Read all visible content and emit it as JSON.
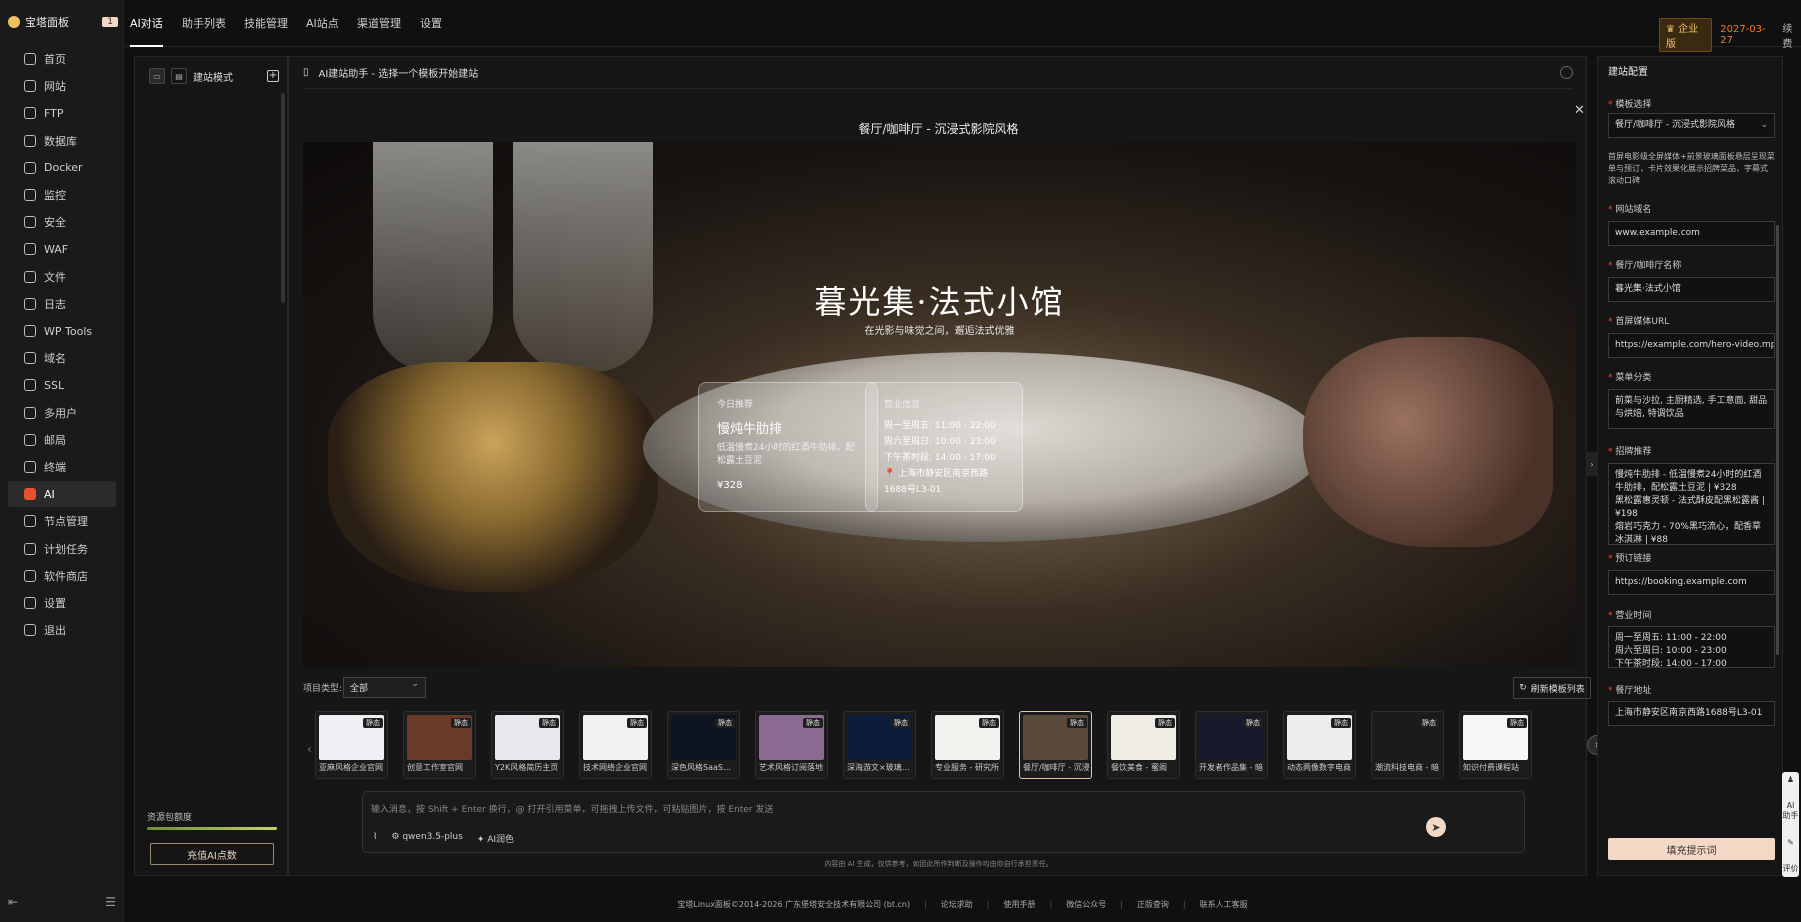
{
  "brand": {
    "name": "宝塔面板",
    "badge": "1"
  },
  "sidebar": {
    "items": [
      {
        "label": "首页",
        "icon": "home-icon"
      },
      {
        "label": "网站",
        "icon": "globe-icon"
      },
      {
        "label": "FTP",
        "icon": "ftp-icon"
      },
      {
        "label": "数据库",
        "icon": "database-icon"
      },
      {
        "label": "Docker",
        "icon": "docker-icon"
      },
      {
        "label": "监控",
        "icon": "monitor-icon"
      },
      {
        "label": "安全",
        "icon": "shield-icon"
      },
      {
        "label": "WAF",
        "icon": "waf-icon"
      },
      {
        "label": "文件",
        "icon": "folder-icon"
      },
      {
        "label": "日志",
        "icon": "log-icon"
      },
      {
        "label": "WP Tools",
        "icon": "wordpress-icon"
      },
      {
        "label": "域名",
        "icon": "domain-icon"
      },
      {
        "label": "SSL",
        "icon": "ssl-icon"
      },
      {
        "label": "多用户",
        "icon": "users-icon"
      },
      {
        "label": "邮局",
        "icon": "mail-icon"
      },
      {
        "label": "终端",
        "icon": "terminal-icon"
      },
      {
        "label": "AI",
        "icon": "ai-icon"
      },
      {
        "label": "节点管理",
        "icon": "node-icon"
      },
      {
        "label": "计划任务",
        "icon": "cron-icon"
      },
      {
        "label": "软件商店",
        "icon": "store-icon"
      },
      {
        "label": "设置",
        "icon": "gear-icon"
      },
      {
        "label": "退出",
        "icon": "logout-icon"
      }
    ],
    "active": "AI"
  },
  "topnav": {
    "tabs": [
      "AI对话",
      "助手列表",
      "技能管理",
      "AI站点",
      "渠道管理",
      "设置"
    ],
    "edition": "企业版",
    "expire_date": "2027-03-27",
    "renew": "续费"
  },
  "left_panel": {
    "title": "建站模式",
    "usage_label": "资源包额度",
    "recharge_label": "充值AI点数"
  },
  "main": {
    "header": "AI建站助手 - 选择一个模板开始建站",
    "template_title": "餐厅/咖啡厅 - 沉浸式影院风格",
    "preview": {
      "title": "暮光集·法式小馆",
      "subtitle": "在光影与味觉之间，邂逅法式优雅",
      "card1": {
        "kicker": "今日推荐",
        "heading": "慢炖牛肋排",
        "desc": "低温慢煮24小时的红酒牛肋排，配松露土豆泥",
        "price": "¥328"
      },
      "card2": {
        "kicker": "营业信息",
        "line1": "周一至周五: 11:00 - 22:00",
        "line2": "周六至周日: 10:00 - 23:00",
        "line3": "下午茶时段: 14:00 - 17:00",
        "address": "📍 上海市静安区南京西路1688号L3-01"
      }
    },
    "filter_label": "项目类型:",
    "filter_value": "全部",
    "refresh_label": "刷新模板列表",
    "templates": [
      {
        "label": "亚麻风格企业官网",
        "tag": "静态",
        "bg": "#eef0f4"
      },
      {
        "label": "创意工作室官网",
        "tag": "静态",
        "bg": "#6a3a28"
      },
      {
        "label": "Y2K风格简历主页",
        "tag": "静态",
        "bg": "#e6e8ec"
      },
      {
        "label": "技术网络企业官网",
        "tag": "静态",
        "bg": "#f2f2f2"
      },
      {
        "label": "深色风格SaaS产品",
        "tag": "静态",
        "bg": "#0e1420"
      },
      {
        "label": "艺术风格订阅落地",
        "tag": "静态",
        "bg": "#8a6a90"
      },
      {
        "label": "深海游文×玻璃质感",
        "tag": "静态",
        "bg": "#0c1c3a"
      },
      {
        "label": "专业服务 - 研究所",
        "tag": "静态",
        "bg": "#f4f2ee"
      },
      {
        "label": "餐厅/咖啡厅 - 沉浸",
        "tag": "静态",
        "bg": "#5a4a3a"
      },
      {
        "label": "餐饮美食 - 蜜阁",
        "tag": "静态",
        "bg": "#f0ece6"
      },
      {
        "label": "开发者作品集 - 暗",
        "tag": "静态",
        "bg": "#161a2a"
      },
      {
        "label": "动态两像数字电商",
        "tag": "静态",
        "bg": "#eeeeee"
      },
      {
        "label": "潮流科技电商 - 暗",
        "tag": "静态",
        "bg": "#1a1a1a"
      },
      {
        "label": "知识付费课程站",
        "tag": "静态",
        "bg": "#f6f6f6"
      }
    ],
    "chat": {
      "placeholder": "输入消息，按 Shift + Enter 换行，@ 打开引用菜单，可拖拽上传文件，可粘贴图片，按 Enter 发送",
      "model": "qwen3.5-plus",
      "ai_color": "AI润色"
    },
    "disclaimer": "内容由 AI 生成，仅供参考，如因此所作判断及操作均由你自行承担责任。"
  },
  "config": {
    "title": "建站配置",
    "template_label": "模板选择",
    "template_value": "餐厅/咖啡厅 - 沉浸式影院风格",
    "template_desc": "首屏电影级全屏媒体+前景玻璃面板悬层呈现菜单与预订，卡片效果化展示招牌菜品，字幕式滚动口碑",
    "domain_label": "网站域名",
    "domain_value": "www.example.com",
    "name_label": "餐厅/咖啡厅名称",
    "name_value": "暮光集·法式小馆",
    "media_label": "首屏媒体URL",
    "media_value": "https://example.com/hero-video.mp4",
    "menu_label": "菜单分类",
    "menu_value": "前菜与沙拉, 主厨精选, 手工意面, 甜品与烘焙, 特调饮品",
    "signature_label": "招牌推荐",
    "signature_value": "慢炖牛肋排 - 低温慢煮24小时的红酒牛肋排，配松露土豆泥 | ¥328\n黑松露惠灵顿 - 法式酥皮配黑松露酱 | ¥198\n熔岩巧克力 - 70%黑巧流心，配香草冰淇淋 | ¥88",
    "booking_label": "预订链接",
    "booking_value": "https://booking.example.com",
    "hours_label": "营业时间",
    "hours_value": "周一至周五: 11:00 - 22:00\n周六至周日: 10:00 - 23:00\n下午茶时段: 14:00 - 17:00",
    "address_label": "餐厅地址",
    "address_value": "上海市静安区南京西路1688号L3-01",
    "submit_label": "填充提示词"
  },
  "floatbar": {
    "ai": "AI 助手",
    "rate": "评价"
  },
  "footer": {
    "copyright": "宝塔Linux面板©2014-2026 广东堡塔安全技术有限公司 (bt.cn)",
    "links": [
      "论坛求助",
      "使用手册",
      "微信公众号",
      "正版查询",
      "联系人工客服"
    ]
  },
  "colors": {
    "accent": "#e8502e",
    "peach": "#f4d8c6",
    "gold": "#f0c070",
    "date": "#f07a30"
  }
}
